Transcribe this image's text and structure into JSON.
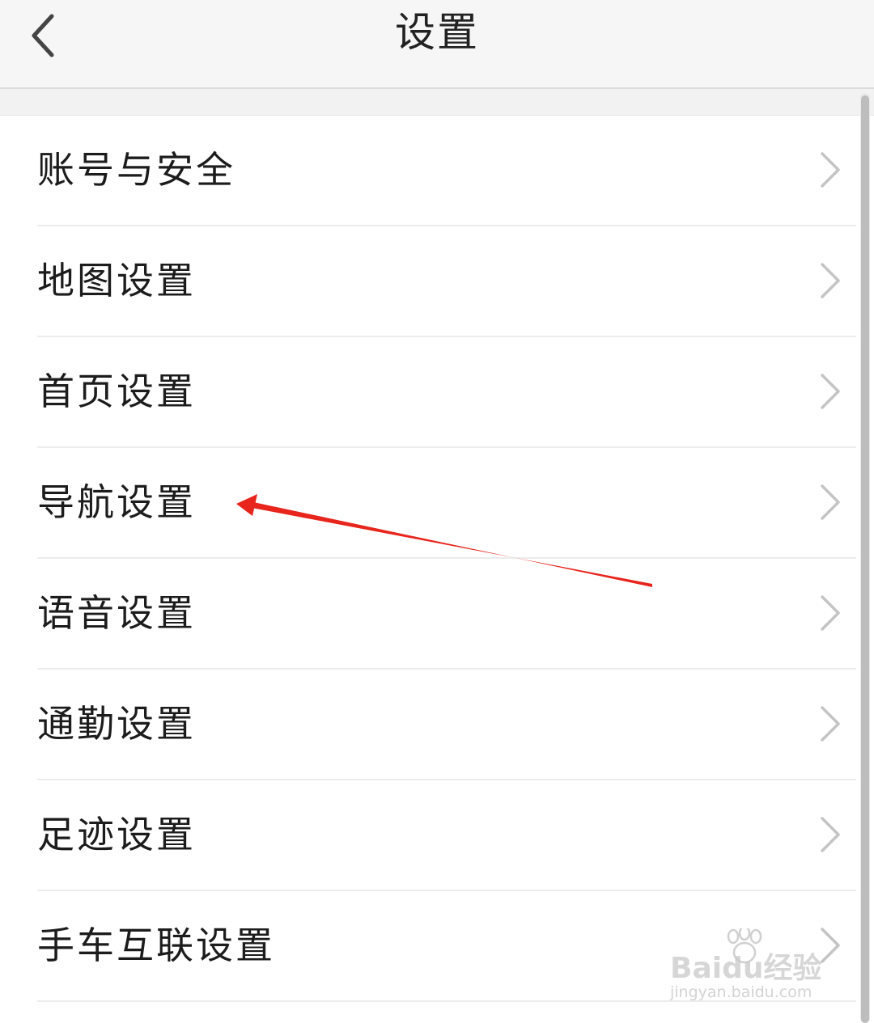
{
  "header": {
    "title": "设置",
    "back_icon": "chevron-left-icon"
  },
  "settings": {
    "items": [
      {
        "label": "账号与安全",
        "icon": "chevron-right-icon"
      },
      {
        "label": "地图设置",
        "icon": "chevron-right-icon"
      },
      {
        "label": "首页设置",
        "icon": "chevron-right-icon"
      },
      {
        "label": "导航设置",
        "icon": "chevron-right-icon"
      },
      {
        "label": "语音设置",
        "icon": "chevron-right-icon"
      },
      {
        "label": "通勤设置",
        "icon": "chevron-right-icon"
      },
      {
        "label": "足迹设置",
        "icon": "chevron-right-icon"
      },
      {
        "label": "手车互联设置",
        "icon": "chevron-right-icon"
      }
    ]
  },
  "annotation": {
    "arrow_color": "#e8251c",
    "points_to": "导航设置"
  },
  "watermark": {
    "brand": "Baidu经验",
    "url": "jingyan.baidu.com"
  },
  "colors": {
    "header_bg": "#f6f6f6",
    "text": "#1c1c1c",
    "chevron": "#c4c4c4"
  }
}
